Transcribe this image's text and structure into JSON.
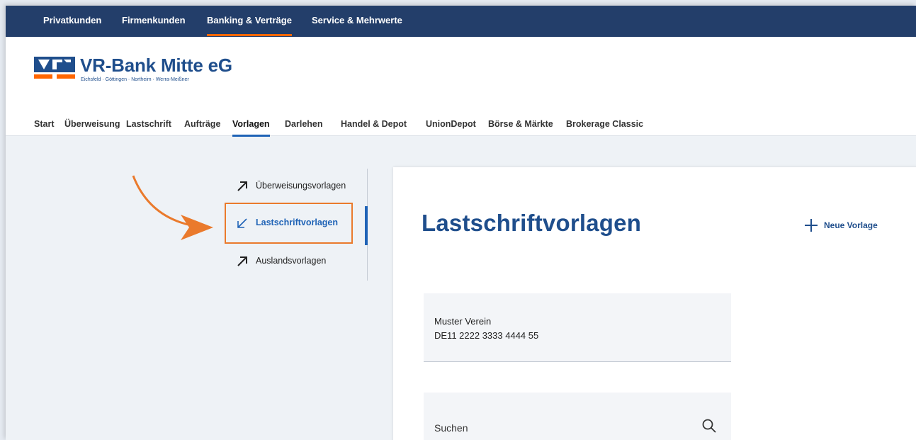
{
  "topnav": {
    "items": [
      {
        "label": "Privatkunden"
      },
      {
        "label": "Firmenkunden"
      },
      {
        "label": "Banking & Verträge",
        "active": true
      },
      {
        "label": "Service & Mehrwerte"
      }
    ]
  },
  "brand": {
    "name": "VR-Bank Mitte eG",
    "subline": "Eichsfeld · Göttingen · Northeim · Werra-Meißner"
  },
  "subnav": {
    "items": [
      {
        "label": "Start"
      },
      {
        "label": "Überweisung"
      },
      {
        "label": "Lastschrift"
      },
      {
        "label": "Aufträge"
      },
      {
        "label": "Vorlagen",
        "active": true
      },
      {
        "label": "Darlehen"
      },
      {
        "label": "Handel & Depot"
      },
      {
        "label": "UnionDepot"
      },
      {
        "label": "Börse & Märkte"
      },
      {
        "label": "Brokerage Classic"
      }
    ]
  },
  "sidenav": {
    "items": [
      {
        "label": "Überweisungsvorlagen",
        "icon": "arrow-up-right-icon"
      },
      {
        "label": "Lastschriftvorlagen",
        "icon": "arrow-down-left-icon",
        "active": true
      },
      {
        "label": "Auslandsvorlagen",
        "icon": "arrow-up-right-icon"
      }
    ]
  },
  "main": {
    "title": "Lastschriftvorlagen",
    "new_label": "Neue Vorlage",
    "templates": [
      {
        "name": "Muster Verein",
        "iban": "DE11 2222 3333 4444 55"
      }
    ],
    "search": {
      "placeholder": "Suchen",
      "value": ""
    }
  },
  "colors": {
    "primary": "#1f4e8c",
    "nav_bg": "#233e6a",
    "accent": "#ff6600",
    "highlight": "#ea7a2c"
  }
}
